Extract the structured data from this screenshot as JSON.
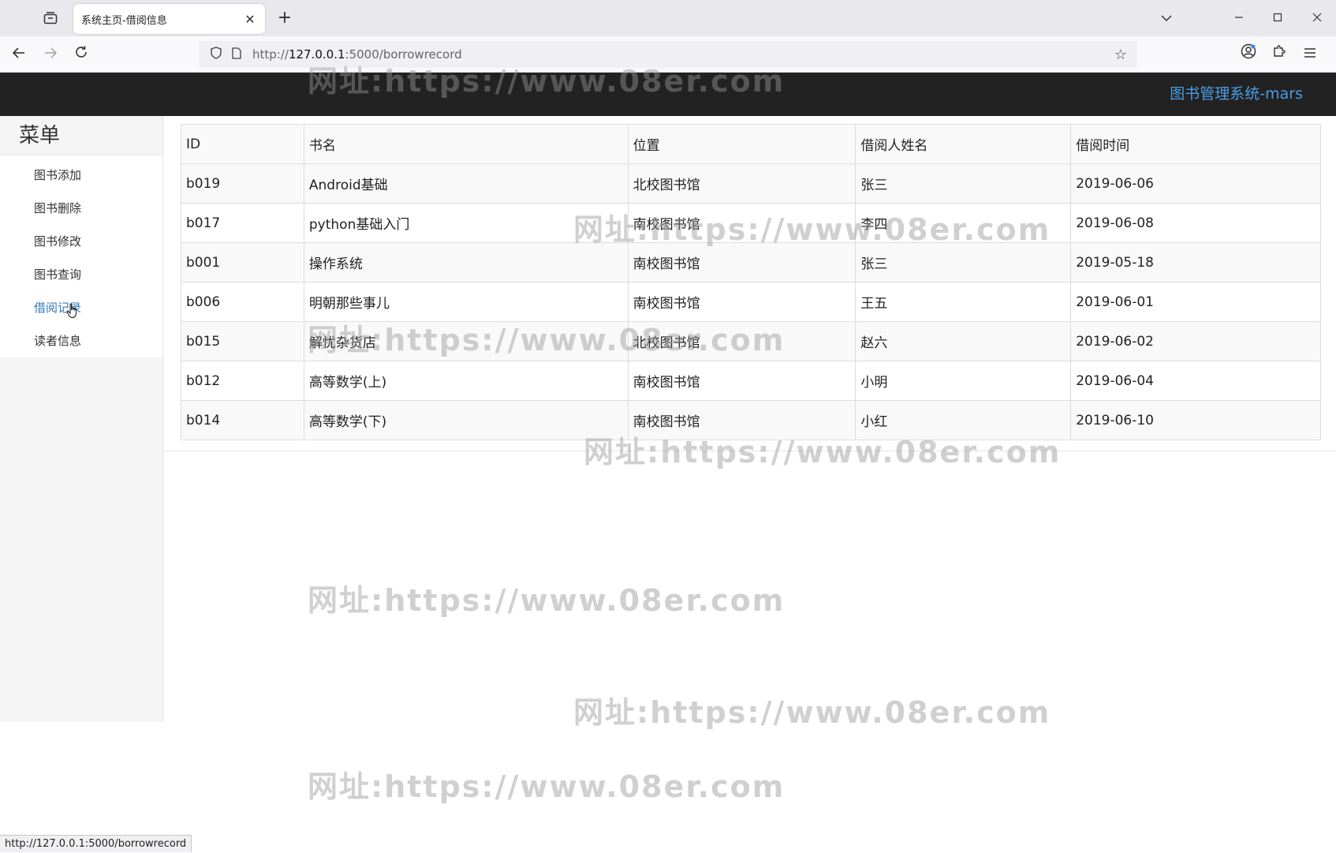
{
  "browser": {
    "tab_title": "系统主页-借阅信息",
    "url_scheme": "http://",
    "url_host": "127.0.0.1",
    "url_rest": ":5000/borrowrecord",
    "status_url": "http://127.0.0.1:5000/borrowrecord"
  },
  "topbar": {
    "brand": "图书管理系统-mars"
  },
  "sidebar": {
    "title": "菜单",
    "items": [
      {
        "label": "图书添加"
      },
      {
        "label": "图书删除"
      },
      {
        "label": "图书修改"
      },
      {
        "label": "图书查询"
      },
      {
        "label": "借阅记录",
        "active": true
      },
      {
        "label": "读者信息"
      }
    ]
  },
  "table": {
    "headers": [
      "ID",
      "书名",
      "位置",
      "借阅人姓名",
      "借阅时间"
    ],
    "rows": [
      [
        "b019",
        "Android基础",
        "北校图书馆",
        "张三",
        "2019-06-06"
      ],
      [
        "b017",
        "python基础入门",
        "南校图书馆",
        "李四",
        "2019-06-08"
      ],
      [
        "b001",
        "操作系统",
        "南校图书馆",
        "张三",
        "2019-05-18"
      ],
      [
        "b006",
        "明朝那些事儿",
        "南校图书馆",
        "王五",
        "2019-06-01"
      ],
      [
        "b015",
        "解忧杂货店",
        "北校图书馆",
        "赵六",
        "2019-06-02"
      ],
      [
        "b012",
        "高等数学(上)",
        "南校图书馆",
        "小明",
        "2019-06-04"
      ],
      [
        "b014",
        "高等数学(下)",
        "南校图书馆",
        "小红",
        "2019-06-10"
      ]
    ]
  },
  "watermark": "网址:https://www.08er.com",
  "icons": {
    "tab_overview": "tab-overview-icon",
    "close": "close-icon",
    "new_tab": "plus-icon",
    "back": "back-arrow-icon",
    "forward": "forward-arrow-icon",
    "reload": "reload-icon",
    "shield": "shield-icon",
    "page": "page-icon",
    "star": "star-icon",
    "account": "account-icon",
    "extensions": "puzzle-icon",
    "menu": "hamburger-menu-icon"
  },
  "colors": {
    "topbar_bg": "#222222",
    "brand": "#4a9ee6",
    "active_link": "#337ab7"
  }
}
